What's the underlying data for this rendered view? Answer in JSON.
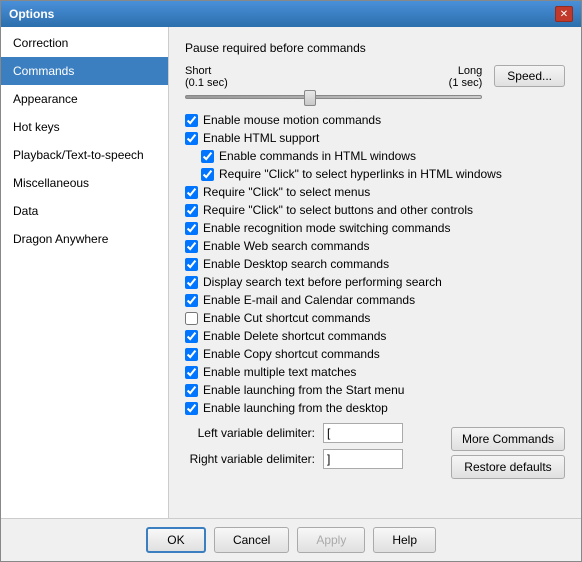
{
  "window": {
    "title": "Options",
    "close_label": "✕"
  },
  "sidebar": {
    "items": [
      {
        "id": "correction",
        "label": "Correction",
        "active": false
      },
      {
        "id": "commands",
        "label": "Commands",
        "active": true
      },
      {
        "id": "appearance",
        "label": "Appearance",
        "active": false
      },
      {
        "id": "hot-keys",
        "label": "Hot keys",
        "active": false
      },
      {
        "id": "playback",
        "label": "Playback/Text-to-speech",
        "active": false
      },
      {
        "id": "miscellaneous",
        "label": "Miscellaneous",
        "active": false
      },
      {
        "id": "data",
        "label": "Data",
        "active": false
      },
      {
        "id": "dragon-anywhere",
        "label": "Dragon Anywhere",
        "active": false
      }
    ]
  },
  "main": {
    "pause_label": "Pause required before commands",
    "slider": {
      "short_label": "Short",
      "short_val": "(0.1 sec)",
      "long_label": "Long",
      "long_val": "(1 sec)"
    },
    "speed_btn": "Speed...",
    "checkboxes": [
      {
        "id": "mouse-motion",
        "label": "Enable mouse motion commands",
        "checked": true,
        "indent": 0
      },
      {
        "id": "html-support",
        "label": "Enable HTML support",
        "checked": true,
        "indent": 0
      },
      {
        "id": "html-commands",
        "label": "Enable commands in HTML windows",
        "checked": true,
        "indent": 1
      },
      {
        "id": "html-hyperlinks",
        "label": "Require \"Click\" to select hyperlinks in HTML windows",
        "checked": true,
        "indent": 1
      },
      {
        "id": "require-click-menus",
        "label": "Require \"Click\" to select menus",
        "checked": true,
        "indent": 0
      },
      {
        "id": "require-click-buttons",
        "label": "Require \"Click\" to select buttons and other controls",
        "checked": true,
        "indent": 0
      },
      {
        "id": "recognition-switching",
        "label": "Enable recognition mode switching commands",
        "checked": true,
        "indent": 0
      },
      {
        "id": "web-search",
        "label": "Enable Web search commands",
        "checked": true,
        "indent": 0
      },
      {
        "id": "desktop-search",
        "label": "Enable Desktop search commands",
        "checked": true,
        "indent": 0
      },
      {
        "id": "display-search",
        "label": "Display search text before performing search",
        "checked": true,
        "indent": 0
      },
      {
        "id": "email-calendar",
        "label": "Enable E-mail and Calendar commands",
        "checked": true,
        "indent": 0
      },
      {
        "id": "cut-shortcut",
        "label": "Enable Cut shortcut commands",
        "checked": false,
        "indent": 0
      },
      {
        "id": "delete-shortcut",
        "label": "Enable Delete shortcut commands",
        "checked": true,
        "indent": 0
      },
      {
        "id": "copy-shortcut",
        "label": "Enable Copy shortcut commands",
        "checked": true,
        "indent": 0
      },
      {
        "id": "multiple-text",
        "label": "Enable multiple text matches",
        "checked": true,
        "indent": 0
      },
      {
        "id": "start-menu",
        "label": "Enable launching from the Start menu",
        "checked": true,
        "indent": 0
      },
      {
        "id": "desktop",
        "label": "Enable launching from the desktop",
        "checked": true,
        "indent": 0
      }
    ],
    "left_delimiter_label": "Left variable delimiter:",
    "left_delimiter_value": "[",
    "right_delimiter_label": "Right variable delimiter:",
    "right_delimiter_value": "]",
    "more_commands_btn": "More Commands",
    "restore_defaults_btn": "Restore defaults"
  },
  "bottom": {
    "ok": "OK",
    "cancel": "Cancel",
    "apply": "Apply",
    "help": "Help"
  }
}
